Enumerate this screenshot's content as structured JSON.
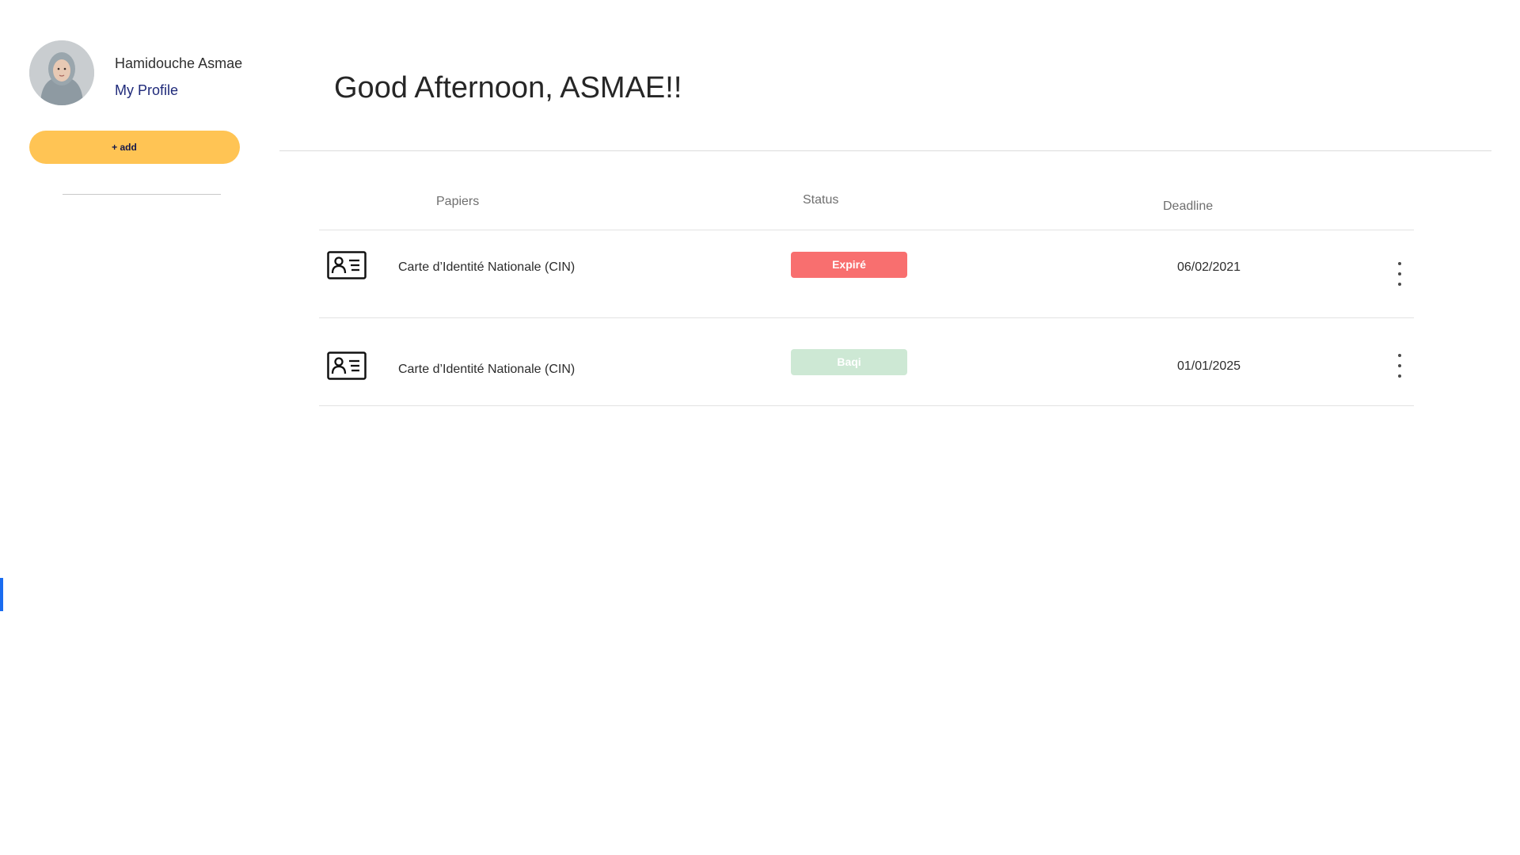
{
  "user": {
    "name": "Hamidouche Asmae",
    "profile_link": "My Profile"
  },
  "sidebar": {
    "add_label": "+ add"
  },
  "main": {
    "greeting": "Good Afternoon, ASMAE!!"
  },
  "table": {
    "headers": {
      "papers": "Papiers",
      "status": "Status",
      "deadline": "Deadline"
    },
    "rows": [
      {
        "document": "Carte d’Identité Nationale (CIN)",
        "status": "Expiré",
        "deadline": "06/02/2021"
      },
      {
        "document": "Carte d’Identité Nationale (CIN)",
        "status": "Baqi",
        "deadline": "01/01/2025"
      }
    ]
  },
  "colors": {
    "add_button": "#ffc454",
    "status_expired": "#f86f6f",
    "status_baqi": "#cde8d4",
    "profile_link": "#1f2a7a",
    "active_marker": "#1a6cf0"
  },
  "icons": {
    "row_icon": "id-card-icon",
    "row_menu": "more-vertical-icon"
  }
}
